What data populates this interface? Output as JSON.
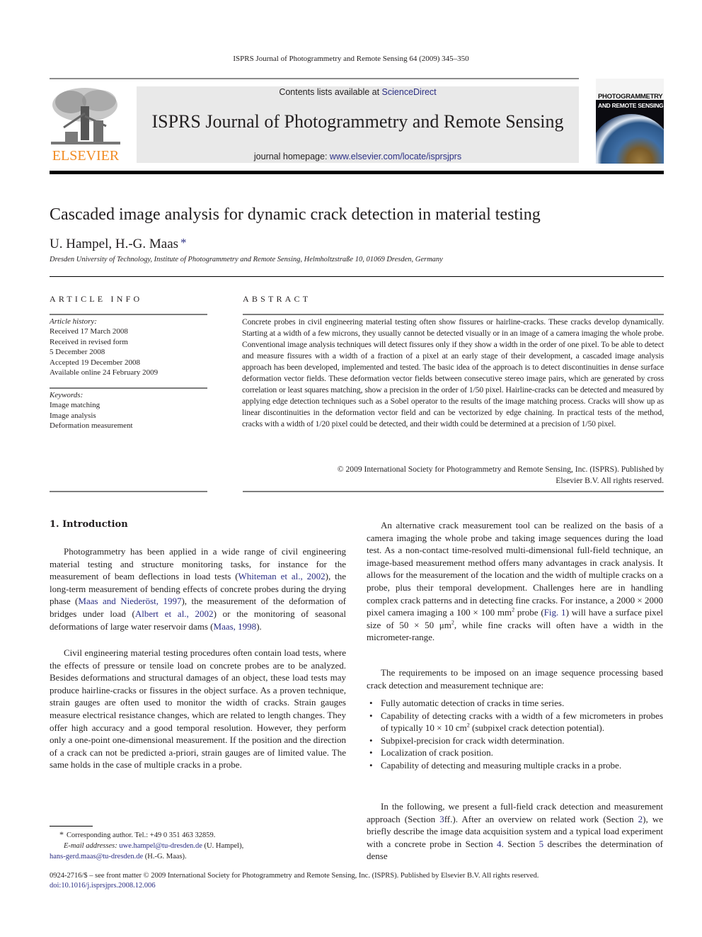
{
  "running_head": "ISPRS Journal of Photogrammetry and Remote Sensing 64 (2009) 345–350",
  "publisher_logo": {
    "wordmark": "ELSEVIER",
    "icon": "elsevier-tree-icon",
    "color": "#f18a21"
  },
  "masthead": {
    "contents_prefix": "Contents lists available at ",
    "contents_link": "ScienceDirect",
    "journal_name": "ISPRS Journal of Photogrammetry and Remote Sensing",
    "homepage_prefix": "journal homepage: ",
    "homepage_link": "www.elsevier.com/locate/isprsjprs",
    "background": "#e9e9e9",
    "link_color": "#2b2e83"
  },
  "cover": {
    "line1": "PHOTOGRAMMETRY",
    "line2": "AND REMOTE SENSING"
  },
  "article": {
    "title": "Cascaded image analysis for dynamic crack detection in material testing",
    "authors": "U. Hampel, H.-G. Maas",
    "corresponding_mark": "*",
    "affiliation": "Dresden University of Technology, Institute of Photogrammetry and Remote Sensing, Helmholtzstraße 10, 01069 Dresden, Germany"
  },
  "article_info": {
    "heading": "ARTICLE INFO",
    "history_label": "Article history:",
    "history": [
      "Received 17 March 2008",
      "Received in revised form",
      "5 December 2008",
      "Accepted 19 December 2008",
      "Available online 24 February 2009"
    ],
    "keywords_label": "Keywords:",
    "keywords": [
      "Image matching",
      "Image analysis",
      "Deformation measurement"
    ]
  },
  "abstract": {
    "heading": "ABSTRACT",
    "text": "Concrete probes in civil engineering material testing often show fissures or hairline-cracks. These cracks develop dynamically. Starting at a width of a few microns, they usually cannot be detected visually or in an image of a camera imaging the whole probe. Conventional image analysis techniques will detect fissures only if they show a width in the order of one pixel. To be able to detect and measure fissures with a width of a fraction of a pixel at an early stage of their development, a cascaded image analysis approach has been developed, implemented and tested. The basic idea of the approach is to detect discontinuities in dense surface deformation vector fields. These deformation vector fields between consecutive stereo image pairs, which are generated by cross correlation or least squares matching, show a precision in the order of 1/50 pixel. Hairline-cracks can be detected and measured by applying edge detection techniques such as a Sobel operator to the results of the image matching process. Cracks will show up as linear discontinuities in the deformation vector field and can be vectorized by edge chaining. In practical tests of the method, cracks with a width of 1/20 pixel could be detected, and their width could be determined at a precision of 1/50 pixel.",
    "copyright_line1": "© 2009 International Society for Photogrammetry and Remote Sensing, Inc. (ISPRS). Published by",
    "copyright_line2": "Elsevier B.V. All rights reserved."
  },
  "section1": {
    "heading": "1.  Introduction",
    "p1": {
      "t1": "Photogrammetry has been applied in a wide range of civil engineering material testing and structure monitoring tasks, for instance for the measurement of beam deflections in load tests (",
      "r1": "Whiteman et al., 2002",
      "t2": "), the long-term measurement of bending effects of concrete probes during the drying phase (",
      "r2": "Maas and Niederöst, 1997",
      "t3": "), the measurement of the deformation of bridges under load (",
      "r3": "Albert et al., 2002",
      "t4": ") or the monitoring of seasonal deformations of large water reservoir dams (",
      "r4": "Maas, 1998",
      "t5": ")."
    },
    "p2": "Civil engineering material testing procedures often contain load tests, where the effects of pressure or tensile load on concrete probes are to be analyzed. Besides deformations and structural damages of an object, these load tests may produce hairline-cracks or fissures in the object surface. As a proven technique, strain gauges are often used to monitor the width of cracks. Strain gauges measure electrical resistance changes, which are related to length changes. They offer high accuracy and a good temporal resolution. However, they perform only a one-point one-dimensional measurement. If the position and the direction of a crack can not be predicted a-priori, strain gauges are of limited value. The same holds in the case of multiple cracks in a probe.",
    "col2_p1": {
      "t1": "An alternative crack measurement tool can be realized on the basis of a camera imaging the whole probe and taking image sequences during the load test. As a non-contact time-resolved multi-dimensional full-field technique, an image-based measurement method offers many advantages in crack analysis. It allows for the measurement of the location and the width of multiple cracks on a probe, plus their temporal development. Challenges here are in handling complex crack patterns and in detecting fine cracks. For instance, a 2000 × 2000 pixel camera imaging a 100 × 100 mm",
      "sup1": "2",
      "t2": " probe (",
      "r1": "Fig. 1",
      "t3": ") will have a surface pixel size of 50 × 50 μm",
      "sup2": "2",
      "t4": ", while fine cracks will often have a width in the micrometer-range."
    },
    "col2_p2": "The requirements to be imposed on an image sequence processing based crack detection and measurement technique are:",
    "bullets": [
      {
        "text": "Fully automatic detection of cracks in time series."
      },
      {
        "text": "Capability of detecting cracks with a width of a few micrometers in probes of typically 10 × 10 cm",
        "sup": "2",
        "tail": " (subpixel crack detection potential)."
      },
      {
        "text": "Subpixel-precision for crack width determination."
      },
      {
        "text": "Localization of crack position."
      },
      {
        "text": "Capability of detecting and measuring multiple cracks in a probe."
      }
    ],
    "col2_p3": {
      "t1": "In the following, we present a full-field crack detection and measurement approach (Section ",
      "r1": "3",
      "t2": "ff.). After an overview on related work (Section ",
      "r2": "2",
      "t3": "), we briefly describe the image data acquisition system and a typical load experiment with a concrete probe in Section ",
      "r3": "4",
      "t4": ". Section ",
      "r4": "5",
      "t5": " describes the determination of dense"
    }
  },
  "footnotes": {
    "mark": "*",
    "corresponding": "Corresponding author. Tel.: +49 0 351 463 32859.",
    "email_label": "E-mail addresses:",
    "email1": "uwe.hampel@tu-dresden.de",
    "email1_name": " (U. Hampel),",
    "email2": "hans-gerd.maas@tu-dresden.de",
    "email2_name": " (H.-G. Maas)."
  },
  "bottom": {
    "issn_line": "0924-2716/$ – see front matter © 2009 International Society for Photogrammetry and Remote Sensing, Inc. (ISPRS). Published by Elsevier B.V. All rights reserved.",
    "doi": "doi:10.1016/j.isprsjprs.2008.12.006"
  }
}
